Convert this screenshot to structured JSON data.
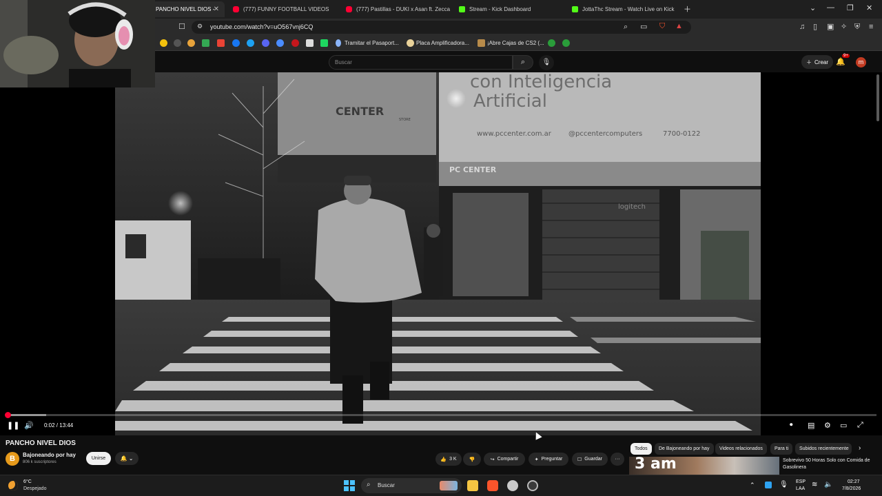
{
  "tabs": [
    {
      "label": "PANCHO NIVEL DIOS -",
      "active": true,
      "favicon": "youtube-icon"
    },
    {
      "label": "(777) FUNNY FOOTBALL VIDEOS",
      "active": false,
      "favicon": "youtube-icon"
    },
    {
      "label": "(777) Pastillas - DUKI x Asan ft. Zecca",
      "active": false,
      "favicon": "youtube-icon"
    },
    {
      "label": "Stream - Kick Dashboard",
      "active": false,
      "favicon": "kick-icon"
    },
    {
      "label": "JottaThc Stream - Watch Live on Kick",
      "active": false,
      "favicon": "kick-icon"
    }
  ],
  "address": {
    "url": "youtube.com/watch?v=uO567vnj6CQ"
  },
  "bookmarks": [
    {
      "label": "Tramitar el Pasaport...",
      "icon": "globe-icon"
    },
    {
      "label": "Placa Amplificadora...",
      "icon": "store-icon"
    },
    {
      "label": "¡Abre Cajas de CS2 (...",
      "icon": "case-icon"
    }
  ],
  "yt_header": {
    "search_placeholder": "Buscar",
    "create_label": "Crear",
    "notif_count": "9+",
    "avatar_letter": "m"
  },
  "player": {
    "time": "0:02 / 13:44",
    "progress": 0.0024,
    "buffered": 0.047
  },
  "video": {
    "title": "PANCHO NIVEL DIOS",
    "channel": "Bajoneando por hay",
    "channel_letter": "B",
    "subscribers": "806 k suscriptores",
    "join_label": "Unirse",
    "likes": "3 K",
    "share_label": "Compartir",
    "ask_label": "Preguntar",
    "save_label": "Guardar",
    "more_label": "···"
  },
  "frame_signs": {
    "store": "CENTER",
    "store_sub": "STORE",
    "banner1": "con Inteligencia",
    "banner2": "Artificial",
    "web": "www.pccenter.com.ar",
    "ig": "@pccentercomputers",
    "phone": "7700-0122",
    "sign2": "PC CENTER",
    "brand": "logitech"
  },
  "chips": [
    {
      "label": "Todos",
      "selected": true
    },
    {
      "label": "De Bajoneando por hay",
      "selected": false
    },
    {
      "label": "Videos relacionados",
      "selected": false
    },
    {
      "label": "Para ti",
      "selected": false
    },
    {
      "label": "Subidos recientemente",
      "selected": false
    }
  ],
  "recommendation": {
    "thumb_text": "3 am",
    "title": "Sobrevivo 50 Horas Solo con Comida de Gasolinera"
  },
  "taskbar": {
    "temp": "6°C",
    "condition": "Despejado",
    "search_label": "Buscar",
    "lang1": "ESP",
    "lang2": "LAA",
    "time": "02:27",
    "date": "7/8/2026"
  },
  "colors": {
    "yt_red": "#ff0033",
    "kick_green": "#53fc18",
    "accent": "#4cc2ff"
  }
}
